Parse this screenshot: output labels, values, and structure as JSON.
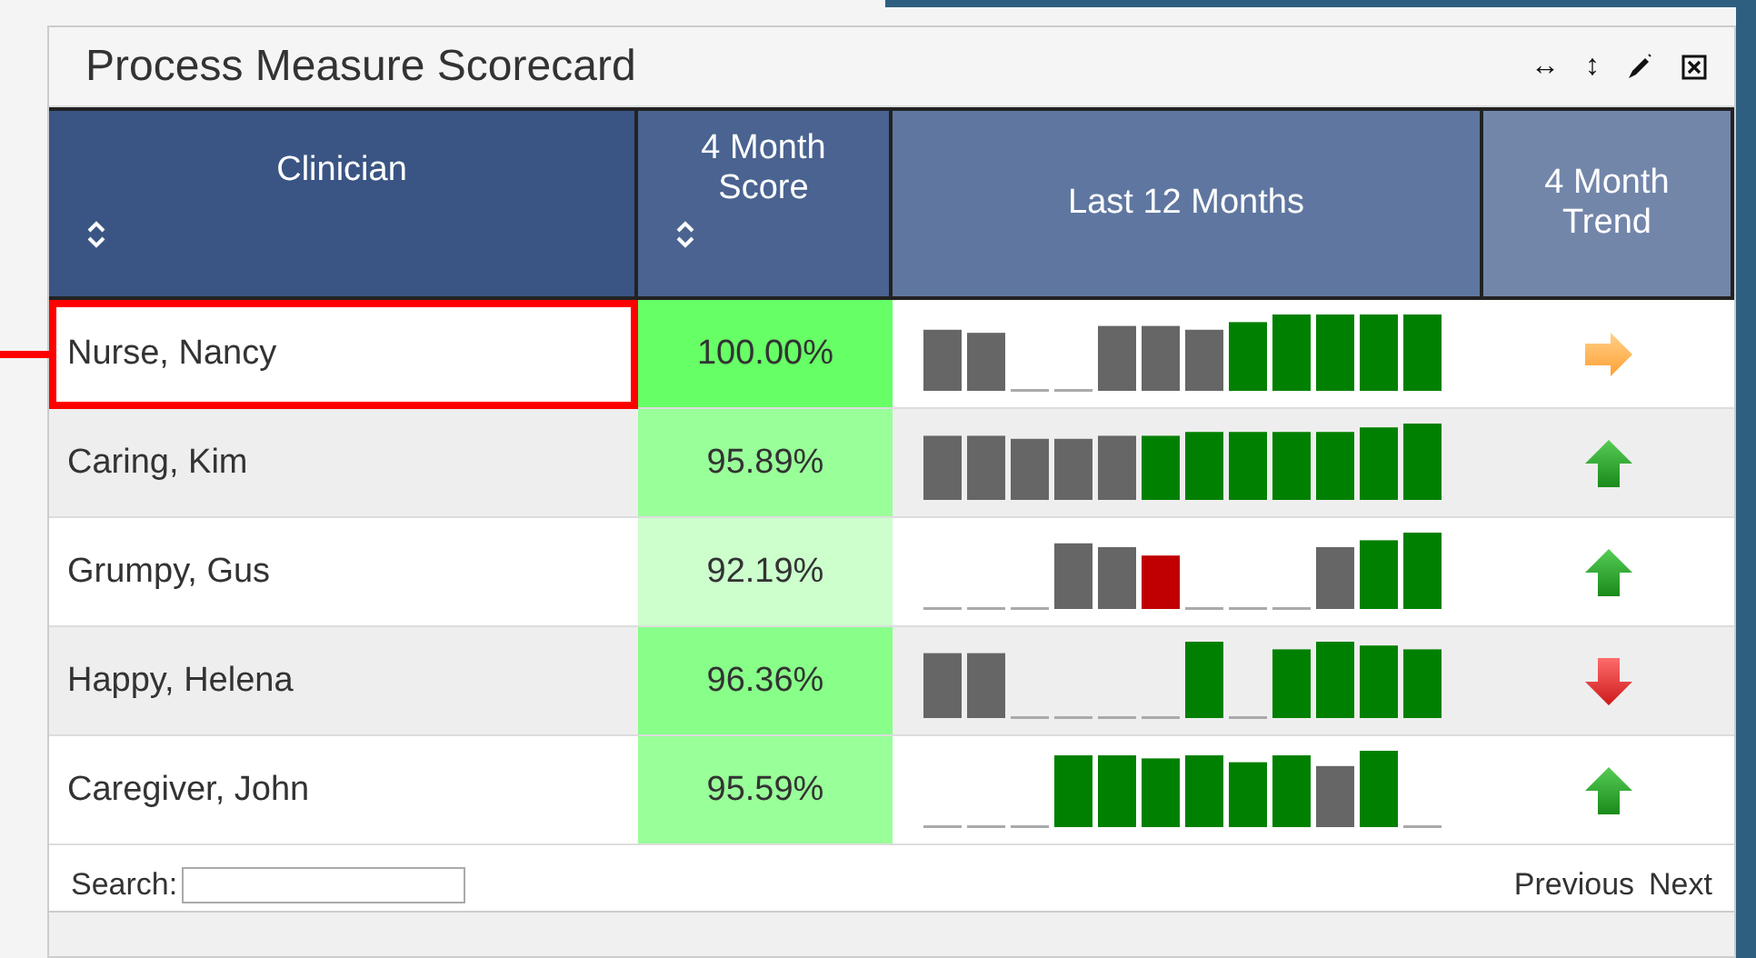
{
  "panel": {
    "title": "Process Measure Scorecard"
  },
  "toolbar": [
    {
      "kind": "width",
      "label": "↔"
    },
    {
      "kind": "height",
      "label": "↕"
    },
    {
      "kind": "edit"
    },
    {
      "kind": "close"
    }
  ],
  "table": {
    "columns": [
      {
        "label": "Clinician",
        "sortable": true,
        "color": "#3a5584"
      },
      {
        "label": "4 Month Score",
        "sortable": true,
        "color": "#4a6390"
      },
      {
        "label": "Last 12 Months",
        "sortable": false,
        "color": "#5f77a0"
      },
      {
        "label": "4 Month Trend",
        "sortable": false,
        "color": "#7286aa"
      }
    ],
    "rows": [
      {
        "name": "Nurse, Nancy",
        "selected": true,
        "score": {
          "text": "100.00%",
          "color": "#66ff66"
        },
        "trend": {
          "kind": "flat"
        }
      },
      {
        "name": "Caring, Kim",
        "selected": false,
        "score": {
          "text": "95.89%",
          "color": "#99ff99"
        },
        "trend": {
          "kind": "up"
        }
      },
      {
        "name": "Grumpy, Gus",
        "selected": false,
        "score": {
          "text": "92.19%",
          "color": "#ccffcc"
        },
        "trend": {
          "kind": "up"
        }
      },
      {
        "name": "Happy, Helena",
        "selected": false,
        "score": {
          "text": "96.36%",
          "color": "#88ff88"
        },
        "trend": {
          "kind": "down"
        }
      },
      {
        "name": "Caregiver, John",
        "selected": false,
        "score": {
          "text": "95.59%",
          "color": "#99ff99"
        },
        "trend": {
          "kind": "up"
        }
      }
    ]
  },
  "footer": {
    "search_label": "Search:",
    "previous": "Previous",
    "next": "Next"
  }
}
